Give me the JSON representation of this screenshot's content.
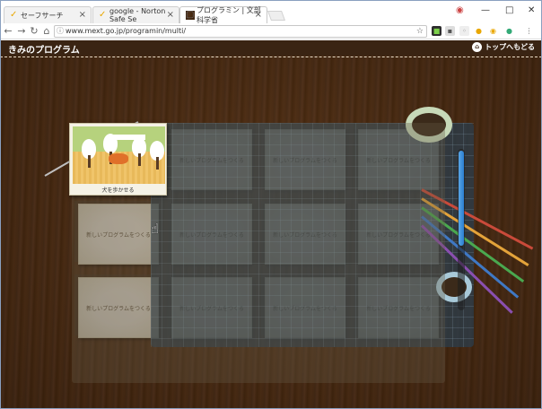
{
  "browser": {
    "tabs": [
      {
        "title": "セーフサーチ",
        "favicon": "norton-check-icon"
      },
      {
        "title": "google - Norton Safe Se",
        "favicon": "norton-check-icon"
      },
      {
        "title": "プログラミン | 文部科学省",
        "favicon": "page-icon"
      }
    ],
    "url": "www.mext.go.jp/programin/multi/"
  },
  "page": {
    "title": "きみのプログラム",
    "top_link": "トップへもどる"
  },
  "programs": {
    "first": {
      "label": "犬を歩かせる"
    },
    "new_label": "新しいプログラムをつくる"
  },
  "colors": {
    "wood": "#4e2f17",
    "header": "#3a2413",
    "card": "#fbf8ec",
    "scroll_accent": "#2b7fd0"
  }
}
